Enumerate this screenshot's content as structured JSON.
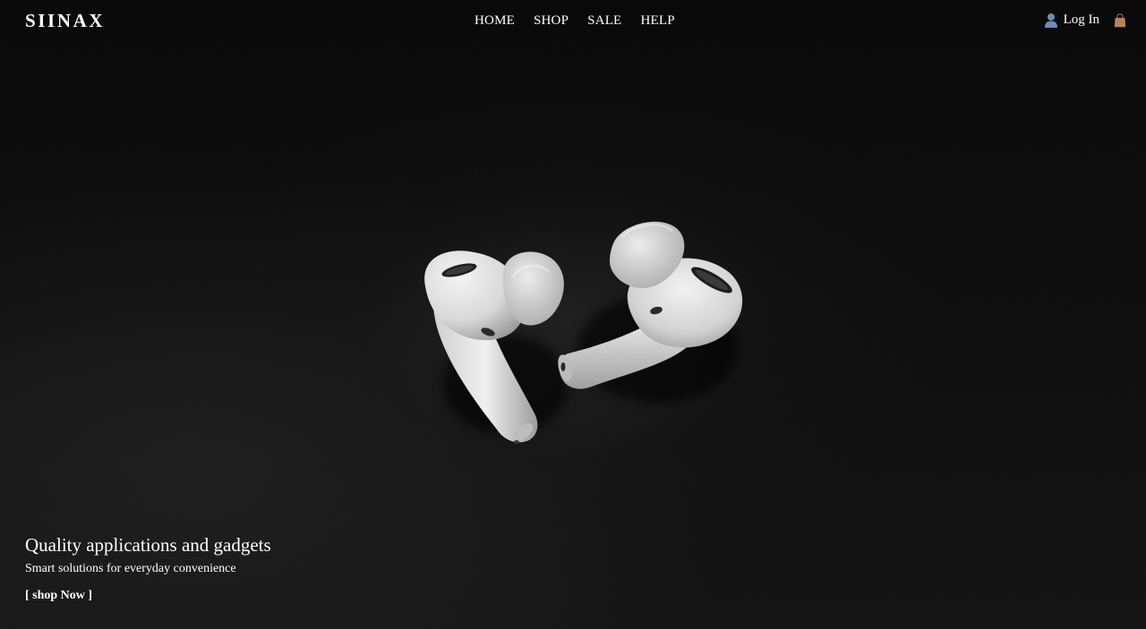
{
  "brand": {
    "name": "SIINAX"
  },
  "nav": {
    "items": [
      {
        "label": "HOME"
      },
      {
        "label": "SHOP"
      },
      {
        "label": "SALE"
      },
      {
        "label": "HELP"
      }
    ],
    "login_label": "Log In",
    "login_icon": "user-icon",
    "cart_icon": "shopping-bag-icon"
  },
  "hero": {
    "headline": "Quality applications and gadgets",
    "subline": "Smart solutions for everyday convenience",
    "cta_label": "[ shop Now ]",
    "image": "white-wireless-earbuds-on-dark-leather"
  },
  "colors": {
    "background": "#060606",
    "text": "#ffffff",
    "user_icon": "#6b8db5",
    "bag_icon": "#b5835a"
  }
}
